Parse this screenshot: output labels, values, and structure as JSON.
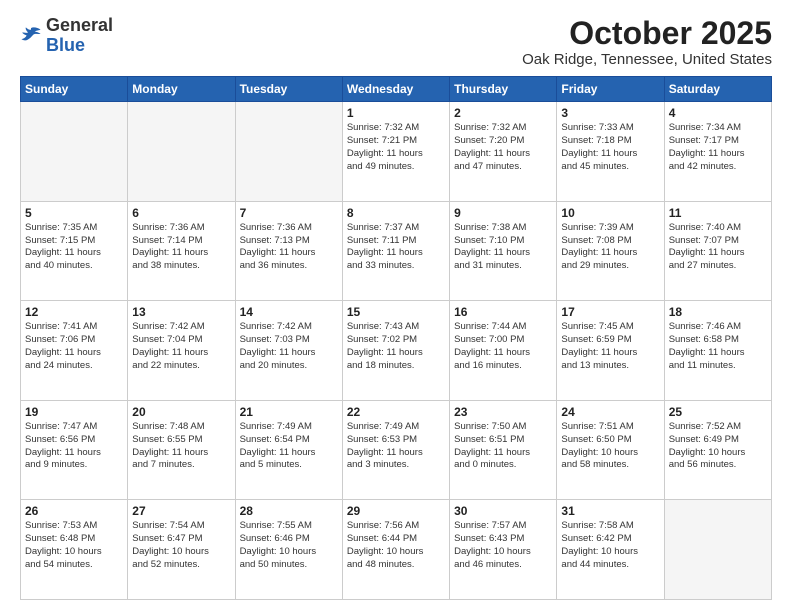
{
  "header": {
    "logo_general": "General",
    "logo_blue": "Blue",
    "title": "October 2025",
    "subtitle": "Oak Ridge, Tennessee, United States"
  },
  "weekdays": [
    "Sunday",
    "Monday",
    "Tuesday",
    "Wednesday",
    "Thursday",
    "Friday",
    "Saturday"
  ],
  "weeks": [
    [
      {
        "day": "",
        "info": ""
      },
      {
        "day": "",
        "info": ""
      },
      {
        "day": "",
        "info": ""
      },
      {
        "day": "1",
        "info": "Sunrise: 7:32 AM\nSunset: 7:21 PM\nDaylight: 11 hours\nand 49 minutes."
      },
      {
        "day": "2",
        "info": "Sunrise: 7:32 AM\nSunset: 7:20 PM\nDaylight: 11 hours\nand 47 minutes."
      },
      {
        "day": "3",
        "info": "Sunrise: 7:33 AM\nSunset: 7:18 PM\nDaylight: 11 hours\nand 45 minutes."
      },
      {
        "day": "4",
        "info": "Sunrise: 7:34 AM\nSunset: 7:17 PM\nDaylight: 11 hours\nand 42 minutes."
      }
    ],
    [
      {
        "day": "5",
        "info": "Sunrise: 7:35 AM\nSunset: 7:15 PM\nDaylight: 11 hours\nand 40 minutes."
      },
      {
        "day": "6",
        "info": "Sunrise: 7:36 AM\nSunset: 7:14 PM\nDaylight: 11 hours\nand 38 minutes."
      },
      {
        "day": "7",
        "info": "Sunrise: 7:36 AM\nSunset: 7:13 PM\nDaylight: 11 hours\nand 36 minutes."
      },
      {
        "day": "8",
        "info": "Sunrise: 7:37 AM\nSunset: 7:11 PM\nDaylight: 11 hours\nand 33 minutes."
      },
      {
        "day": "9",
        "info": "Sunrise: 7:38 AM\nSunset: 7:10 PM\nDaylight: 11 hours\nand 31 minutes."
      },
      {
        "day": "10",
        "info": "Sunrise: 7:39 AM\nSunset: 7:08 PM\nDaylight: 11 hours\nand 29 minutes."
      },
      {
        "day": "11",
        "info": "Sunrise: 7:40 AM\nSunset: 7:07 PM\nDaylight: 11 hours\nand 27 minutes."
      }
    ],
    [
      {
        "day": "12",
        "info": "Sunrise: 7:41 AM\nSunset: 7:06 PM\nDaylight: 11 hours\nand 24 minutes."
      },
      {
        "day": "13",
        "info": "Sunrise: 7:42 AM\nSunset: 7:04 PM\nDaylight: 11 hours\nand 22 minutes."
      },
      {
        "day": "14",
        "info": "Sunrise: 7:42 AM\nSunset: 7:03 PM\nDaylight: 11 hours\nand 20 minutes."
      },
      {
        "day": "15",
        "info": "Sunrise: 7:43 AM\nSunset: 7:02 PM\nDaylight: 11 hours\nand 18 minutes."
      },
      {
        "day": "16",
        "info": "Sunrise: 7:44 AM\nSunset: 7:00 PM\nDaylight: 11 hours\nand 16 minutes."
      },
      {
        "day": "17",
        "info": "Sunrise: 7:45 AM\nSunset: 6:59 PM\nDaylight: 11 hours\nand 13 minutes."
      },
      {
        "day": "18",
        "info": "Sunrise: 7:46 AM\nSunset: 6:58 PM\nDaylight: 11 hours\nand 11 minutes."
      }
    ],
    [
      {
        "day": "19",
        "info": "Sunrise: 7:47 AM\nSunset: 6:56 PM\nDaylight: 11 hours\nand 9 minutes."
      },
      {
        "day": "20",
        "info": "Sunrise: 7:48 AM\nSunset: 6:55 PM\nDaylight: 11 hours\nand 7 minutes."
      },
      {
        "day": "21",
        "info": "Sunrise: 7:49 AM\nSunset: 6:54 PM\nDaylight: 11 hours\nand 5 minutes."
      },
      {
        "day": "22",
        "info": "Sunrise: 7:49 AM\nSunset: 6:53 PM\nDaylight: 11 hours\nand 3 minutes."
      },
      {
        "day": "23",
        "info": "Sunrise: 7:50 AM\nSunset: 6:51 PM\nDaylight: 11 hours\nand 0 minutes."
      },
      {
        "day": "24",
        "info": "Sunrise: 7:51 AM\nSunset: 6:50 PM\nDaylight: 10 hours\nand 58 minutes."
      },
      {
        "day": "25",
        "info": "Sunrise: 7:52 AM\nSunset: 6:49 PM\nDaylight: 10 hours\nand 56 minutes."
      }
    ],
    [
      {
        "day": "26",
        "info": "Sunrise: 7:53 AM\nSunset: 6:48 PM\nDaylight: 10 hours\nand 54 minutes."
      },
      {
        "day": "27",
        "info": "Sunrise: 7:54 AM\nSunset: 6:47 PM\nDaylight: 10 hours\nand 52 minutes."
      },
      {
        "day": "28",
        "info": "Sunrise: 7:55 AM\nSunset: 6:46 PM\nDaylight: 10 hours\nand 50 minutes."
      },
      {
        "day": "29",
        "info": "Sunrise: 7:56 AM\nSunset: 6:44 PM\nDaylight: 10 hours\nand 48 minutes."
      },
      {
        "day": "30",
        "info": "Sunrise: 7:57 AM\nSunset: 6:43 PM\nDaylight: 10 hours\nand 46 minutes."
      },
      {
        "day": "31",
        "info": "Sunrise: 7:58 AM\nSunset: 6:42 PM\nDaylight: 10 hours\nand 44 minutes."
      },
      {
        "day": "",
        "info": ""
      }
    ]
  ]
}
